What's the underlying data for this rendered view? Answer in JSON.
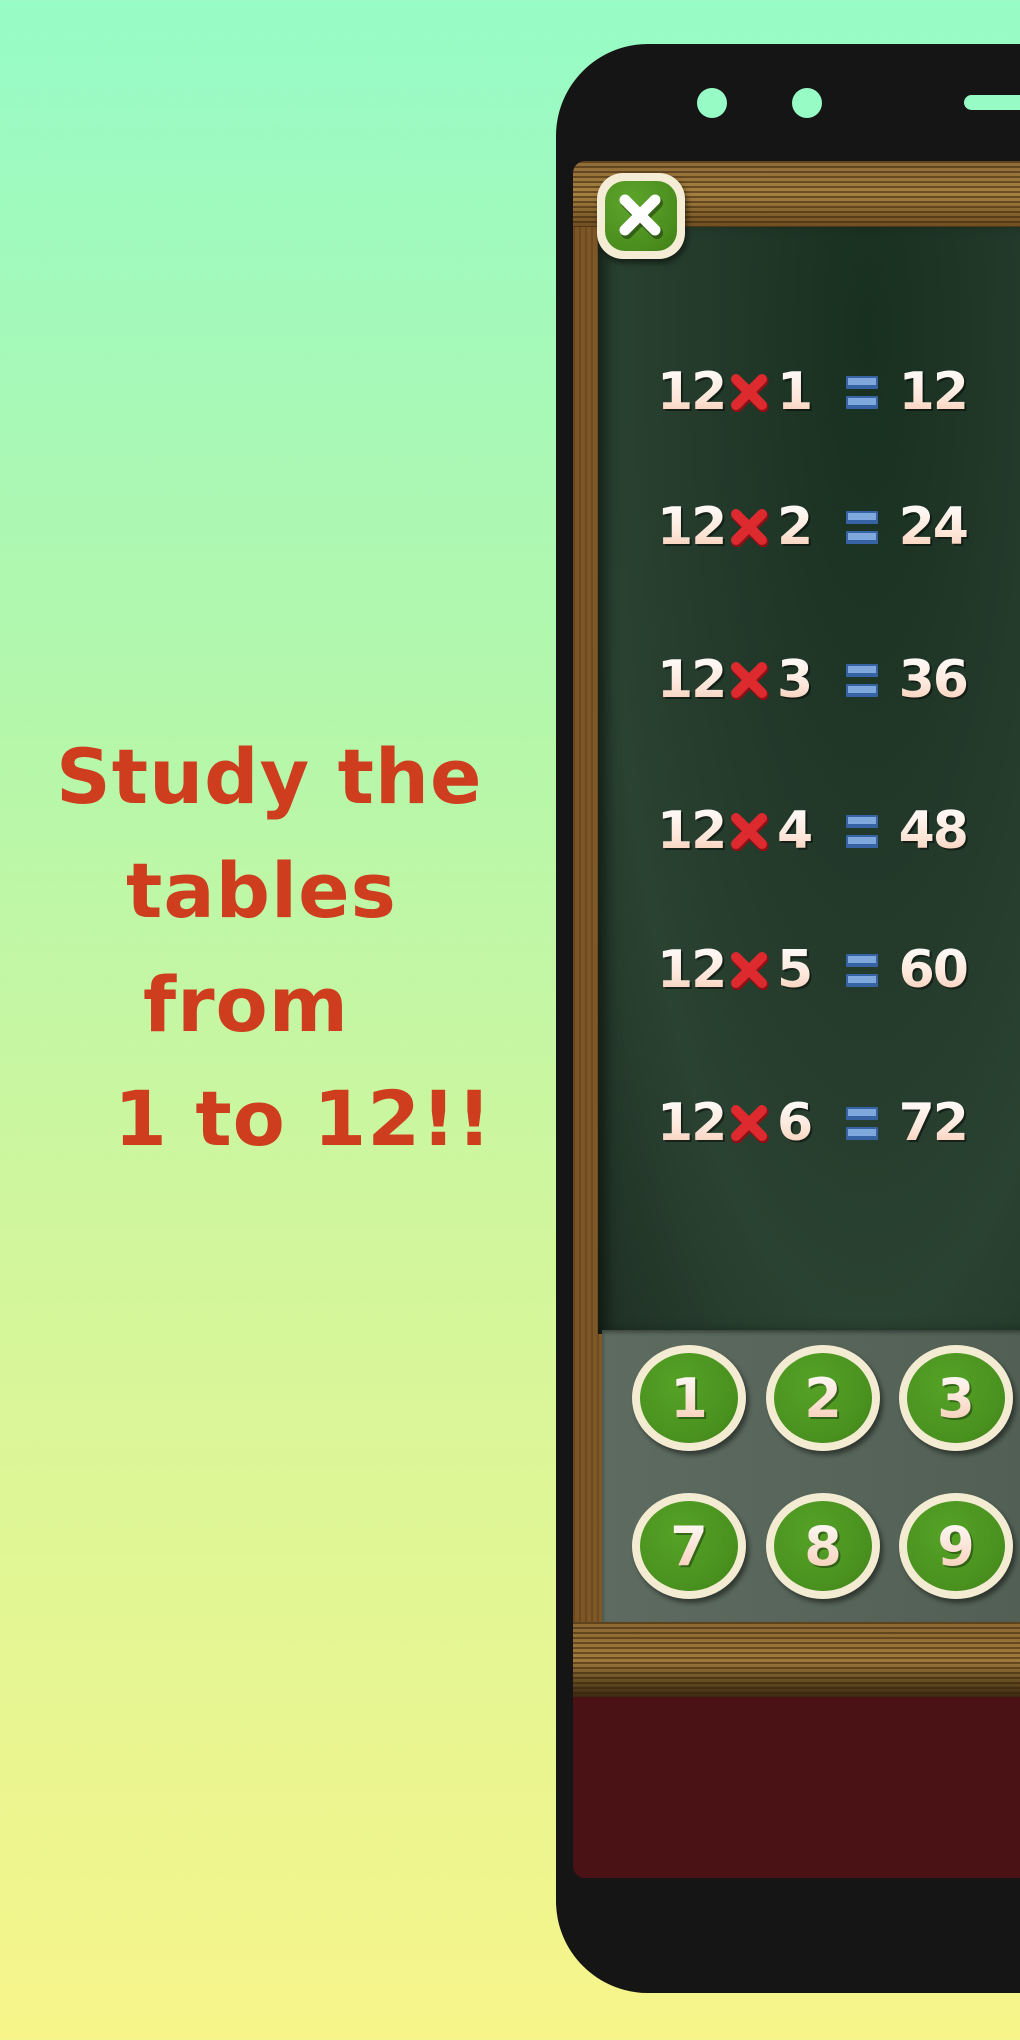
{
  "promo": {
    "lines": [
      "Study the",
      "tables",
      "from",
      "1 to 12!!"
    ],
    "color": "#cd3d1e"
  },
  "app": {
    "close_button": {
      "label": "Close",
      "icon": "close-icon"
    },
    "table_number": 12,
    "equations": [
      {
        "multiplicand": "12",
        "operator": "×",
        "multiplier": "1",
        "equals": "=",
        "result": "12"
      },
      {
        "multiplicand": "12",
        "operator": "×",
        "multiplier": "2",
        "equals": "=",
        "result": "24"
      },
      {
        "multiplicand": "12",
        "operator": "×",
        "multiplier": "3",
        "equals": "=",
        "result": "36"
      },
      {
        "multiplicand": "12",
        "operator": "×",
        "multiplier": "4",
        "equals": "=",
        "result": "48"
      },
      {
        "multiplicand": "12",
        "operator": "×",
        "multiplier": "5",
        "equals": "=",
        "result": "60"
      },
      {
        "multiplicand": "12",
        "operator": "×",
        "multiplier": "6",
        "equals": "=",
        "result": "72"
      }
    ],
    "keypad": {
      "row1": [
        "1",
        "2",
        "3"
      ],
      "row2": [
        "7",
        "8",
        "9"
      ]
    },
    "colors": {
      "chalkboard": "#23392a",
      "button_green": "#4a921f",
      "button_rim": "#f3ecd3",
      "times_red": "#d8262b",
      "equals_blue": "#4a7fc2",
      "footer_maroon": "#4a1214"
    }
  }
}
